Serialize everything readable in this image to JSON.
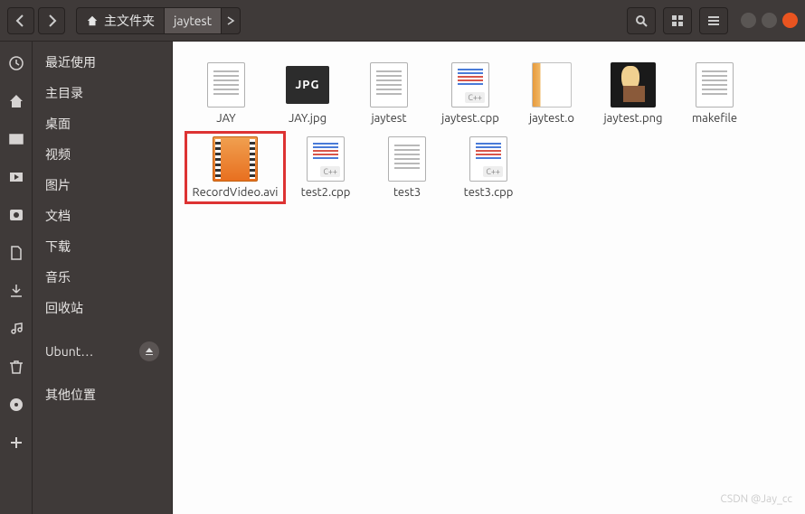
{
  "breadcrumb": {
    "home_label": "主文件夹",
    "current_label": "jaytest"
  },
  "sidebar": {
    "items": [
      {
        "label": "最近使用"
      },
      {
        "label": "主目录"
      },
      {
        "label": "桌面"
      },
      {
        "label": "视频"
      },
      {
        "label": "图片"
      },
      {
        "label": "文档"
      },
      {
        "label": "下载"
      },
      {
        "label": "音乐"
      },
      {
        "label": "回收站"
      },
      {
        "label": "Ubunt…"
      },
      {
        "label": "其他位置"
      }
    ]
  },
  "files": [
    {
      "name": "JAY",
      "type": "doc"
    },
    {
      "name": "JAY.jpg",
      "type": "jpg"
    },
    {
      "name": "jaytest",
      "type": "doc"
    },
    {
      "name": "jaytest.cpp",
      "type": "cpp"
    },
    {
      "name": "jaytest.o",
      "type": "o"
    },
    {
      "name": "jaytest.png",
      "type": "png"
    },
    {
      "name": "makefile",
      "type": "doc"
    },
    {
      "name": "RecordVideo.avi",
      "type": "video",
      "highlighted": true
    },
    {
      "name": "test2.cpp",
      "type": "cpp"
    },
    {
      "name": "test3",
      "type": "doc"
    },
    {
      "name": "test3.cpp",
      "type": "cpp"
    }
  ],
  "jpg_badge": "JPG",
  "watermark": "CSDN @Jay_cc"
}
